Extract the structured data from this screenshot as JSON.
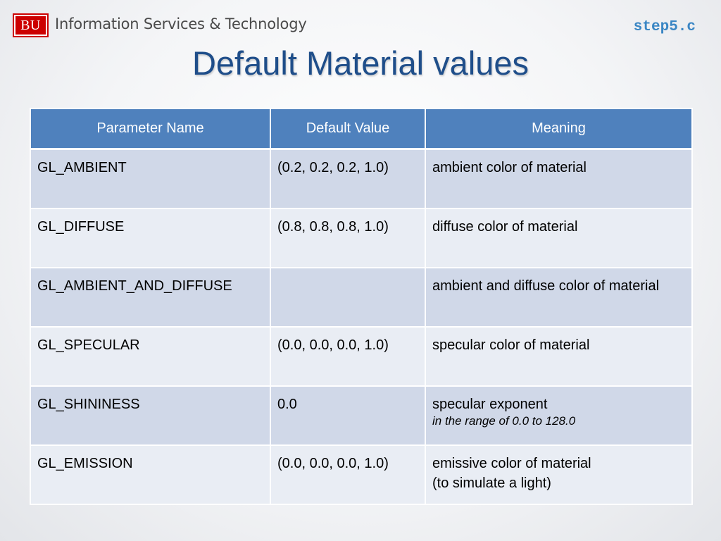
{
  "header": {
    "logo_text": "BU",
    "org_name": "Information Services & Technology",
    "filename": "step5.c"
  },
  "title": "Default Material values",
  "table": {
    "columns": [
      "Parameter Name",
      "Default Value",
      "Meaning"
    ],
    "rows": [
      {
        "name": "GL_AMBIENT",
        "value": "(0.2, 0.2, 0.2, 1.0)",
        "meaning": "ambient color of material"
      },
      {
        "name": "GL_DIFFUSE",
        "value": "(0.8, 0.8, 0.8, 1.0)",
        "meaning": "diffuse color of material"
      },
      {
        "name": "GL_AMBIENT_AND_DIFFUSE",
        "value": "",
        "meaning": "ambient and diffuse color of material"
      },
      {
        "name": "GL_SPECULAR",
        "value": "(0.0, 0.0, 0.0, 1.0)",
        "meaning": "specular color of material"
      },
      {
        "name": "GL_SHININESS",
        "value": "0.0",
        "meaning": "specular exponent",
        "note": "in the range of  0.0 to 128.0"
      },
      {
        "name": "GL_EMISSION",
        "value": "(0.0, 0.0, 0.0, 1.0)",
        "meaning": "emissive color of material",
        "meaning_line2": "(to simulate a light)"
      }
    ]
  },
  "colors": {
    "header_fill": "#4f81bd",
    "row_odd": "#d0d8e8",
    "row_even": "#e9edf4",
    "title": "#1f4e8a",
    "filename": "#3a86c4",
    "logo": "#cc0000"
  }
}
